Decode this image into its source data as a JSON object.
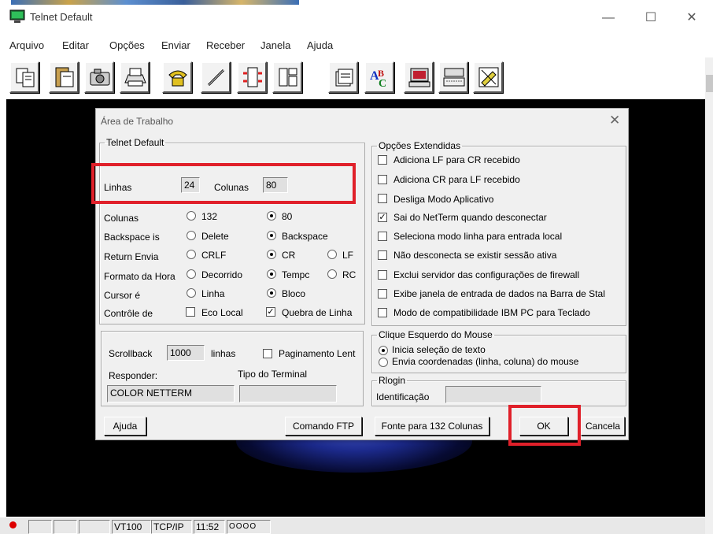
{
  "window": {
    "title": "Telnet Default",
    "minimize": "—",
    "maximize": "☐",
    "close": "✕"
  },
  "menu": [
    "Arquivo",
    "Editar",
    "Opções",
    "Enviar",
    "Receber",
    "Janela",
    "Ajuda"
  ],
  "toolbar_icons": [
    "copy-icon",
    "paste-icon",
    "camera-icon",
    "print-icon",
    "phone-icon",
    "edit-icon",
    "transfer-icon",
    "layout-icon",
    "files-icon",
    "spellcheck-icon",
    "terminal-icon",
    "keyboard-icon",
    "color-icon"
  ],
  "status": {
    "term": "VT100",
    "proto": "TCP/IP",
    "time": "11:52",
    "leds": "OOOO"
  },
  "dialog": {
    "title": "Área de Trabalho",
    "group_main": "Telnet Default",
    "linhas_label": "Linhas",
    "linhas_value": "24",
    "colunas_label": "Colunas",
    "colunas_value": "80",
    "rows": [
      {
        "label": "Colunas",
        "opt1": "132",
        "opt2": "80"
      },
      {
        "label": "Backspace is",
        "opt1": "Delete",
        "opt2": "Backspace"
      },
      {
        "label": "Return Envia",
        "opt1": "CRLF",
        "opt2": "CR",
        "opt3": "LF"
      },
      {
        "label": "Formato da Hora",
        "opt1": "Decorrido",
        "opt2": "Tempc",
        "opt3": "RC"
      },
      {
        "label": "Cursor é",
        "opt1": "Linha",
        "opt2": "Bloco"
      },
      {
        "label": "Contrôle de",
        "opt1": "Eco Local",
        "opt2": "Quebra de Linha"
      }
    ],
    "scrollback_label": "Scrollback",
    "scrollback_value": "1000",
    "linhas_unit": "linhas",
    "paginamento": "Paginamento Lent",
    "responder_label": "Responder:",
    "responder_value": "COLOR NETTERM",
    "tipo_label": "Tipo do Terminal",
    "tipo_value": "",
    "group_ext": "Opções Extendidas",
    "ext": [
      "Adiciona LF para CR recebido",
      "Adiciona CR para LF recebido",
      "Desliga Modo Aplicativo",
      "Sai do NetTerm quando desconectar",
      "Seleciona modo linha para entrada local",
      "Não desconecta se existir sessão ativa",
      "Exclui servidor das configurações de firewall",
      "Exibe janela de entrada de dados na Barra de Stal",
      "Modo de compatibilidade IBM PC para Teclado"
    ],
    "ext_checked": [
      false,
      false,
      false,
      true,
      false,
      false,
      false,
      false,
      false
    ],
    "group_mouse": "Clique Esquerdo do Mouse",
    "mouse1": "Inicia seleção de texto",
    "mouse2": "Envia coordenadas (linha, coluna) do mouse",
    "group_rlogin": "Rlogin",
    "ident_label": "Identificação",
    "ident_value": "",
    "btn_help": "Ajuda",
    "btn_ftp": "Comando FTP",
    "btn_font": "Fonte para 132 Colunas",
    "btn_ok": "OK",
    "btn_cancel": "Cancela",
    "close": "✕"
  },
  "colors": {
    "highlight": "#e0202a",
    "terminal_bg": "#000000",
    "dialog_bg": "#f0f0f0"
  }
}
